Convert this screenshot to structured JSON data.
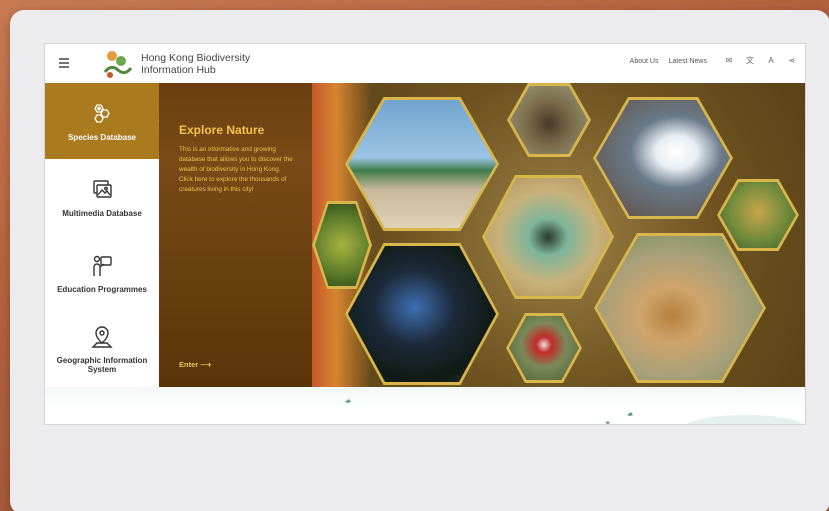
{
  "header": {
    "brand_line1": "Hong Kong Biodiversity",
    "brand_line2": "Information Hub",
    "links": [
      "About Us",
      "Latest News"
    ],
    "icons": [
      "mail-icon",
      "translate-icon",
      "font-size-icon",
      "share-icon"
    ]
  },
  "sidebar": {
    "items": [
      {
        "label": "Species Database",
        "icon": "species-icon",
        "active": true
      },
      {
        "label": "Multimedia Database",
        "icon": "multimedia-icon",
        "active": false
      },
      {
        "label": "Education Programmes",
        "icon": "education-icon",
        "active": false
      },
      {
        "label": "Geographic Information System",
        "icon": "map-pin-icon",
        "active": false
      }
    ]
  },
  "explore": {
    "title": "Explore Nature",
    "text": "This is an informative and growing database that allows you to discover the wealth of biodiversity in Hong Kong. Click here to explore the thousands of creatures living in this city!",
    "enter": "Enter"
  },
  "colors": {
    "accent": "#a97a1e",
    "explore_text": "#f1c24d",
    "panel_bg": "#6b3f10",
    "frame_bg": "#b5633f"
  }
}
